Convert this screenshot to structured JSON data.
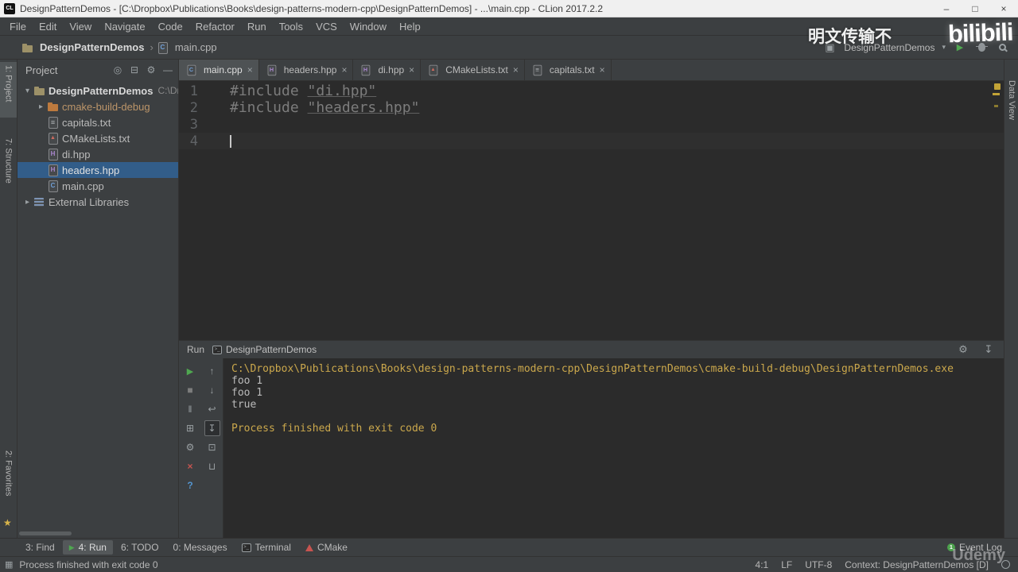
{
  "window": {
    "app_icon_text": "CL",
    "title": "DesignPatternDemos - [C:\\Dropbox\\Publications\\Books\\design-patterns-modern-cpp\\DesignPatternDemos] - ...\\main.cpp - CLion 2017.2.2",
    "controls": {
      "minimize": "–",
      "maximize": "□",
      "close": "×"
    }
  },
  "menu_bar": {
    "items": [
      "File",
      "Edit",
      "View",
      "Navigate",
      "Code",
      "Refactor",
      "Run",
      "Tools",
      "VCS",
      "Window",
      "Help"
    ]
  },
  "navbar": {
    "project": "DesignPatternDemos",
    "separator": "›",
    "file": "main.cpp",
    "run_config": "DesignPatternDemos",
    "dropdown_arrow": "▾"
  },
  "left_strip": {
    "project_tab": "1: Project",
    "structure_tab": "7: Structure",
    "favorites_tab": "2: Favorites",
    "star": "★"
  },
  "right_strip": {
    "data_view_tab": "Data View"
  },
  "project_panel": {
    "header_title": "Project",
    "header_icons": [
      {
        "name": "locate-icon",
        "glyph": "◎"
      },
      {
        "name": "collapse-all-icon",
        "glyph": "⊟"
      },
      {
        "name": "settings-icon",
        "glyph": "⚙"
      },
      {
        "name": "hide-icon",
        "glyph": "—"
      }
    ],
    "tree": [
      {
        "label": "DesignPatternDemos",
        "suffix": "C:\\Drop",
        "icon": "folder",
        "level": 0,
        "expanded": true,
        "bold": true
      },
      {
        "label": "cmake-build-debug",
        "icon": "folder-excluded",
        "level": 1,
        "expanded": false,
        "tint": "#bc9569"
      },
      {
        "label": "capitals.txt",
        "icon": "file-text",
        "level": 1
      },
      {
        "label": "CMakeLists.txt",
        "icon": "file-cmake",
        "level": 1
      },
      {
        "label": "di.hpp",
        "icon": "file-h",
        "level": 1
      },
      {
        "label": "headers.hpp",
        "icon": "file-h",
        "level": 1,
        "selected": true
      },
      {
        "label": "main.cpp",
        "icon": "file-cpp",
        "level": 1
      },
      {
        "label": "External Libraries",
        "icon": "lib",
        "level": 0,
        "expanded": false
      }
    ]
  },
  "editor": {
    "tabs": [
      {
        "label": "main.cpp",
        "icon": "file-cpp",
        "active": true
      },
      {
        "label": "headers.hpp",
        "icon": "file-h"
      },
      {
        "label": "di.hpp",
        "icon": "file-h"
      },
      {
        "label": "CMakeLists.txt",
        "icon": "file-cmake"
      },
      {
        "label": "capitals.txt",
        "icon": "file-text"
      }
    ],
    "close_glyph": "×",
    "lines": [
      {
        "num": "1",
        "segments": [
          {
            "text": "#include ",
            "style": "dim"
          },
          {
            "text": "\"di.hpp\"",
            "style": "dim-underline"
          }
        ]
      },
      {
        "num": "2",
        "segments": [
          {
            "text": "#include ",
            "style": "dim"
          },
          {
            "text": "\"headers.hpp\"",
            "style": "dim-underline"
          }
        ]
      },
      {
        "num": "3",
        "segments": []
      },
      {
        "num": "4",
        "segments": [],
        "caret": true
      }
    ]
  },
  "run_panel": {
    "tab_label": "Run",
    "session_label": "DesignPatternDemos",
    "header_icons": [
      {
        "name": "settings-icon",
        "glyph": "⚙"
      },
      {
        "name": "scroll-down-icon",
        "glyph": "↧"
      }
    ],
    "toolbar_main": [
      {
        "name": "rerun-button",
        "glyph": "▶",
        "color": "#4fa750"
      },
      {
        "name": "stop-button",
        "glyph": "■",
        "color": "#7d7d7d"
      },
      {
        "name": "pause-output-button",
        "glyph": "‖",
        "color": "#9aa0a3"
      },
      {
        "name": "restore-layout-button",
        "glyph": "⊞",
        "color": "#9aa0a3"
      },
      {
        "name": "run-settings-button",
        "glyph": "⚙",
        "color": "#9aa0a3"
      },
      {
        "name": "close-button",
        "glyph": "×",
        "color": "#c75450"
      },
      {
        "name": "help-button",
        "glyph": "?",
        "color": "#5394ce"
      }
    ],
    "toolbar_console": [
      {
        "name": "up-stack-trace-button",
        "glyph": "↑",
        "color": "#9aa0a3"
      },
      {
        "name": "down-stack-trace-button",
        "glyph": "↓",
        "color": "#9aa0a3"
      },
      {
        "name": "soft-wrap-button",
        "glyph": "↩",
        "color": "#9aa0a3"
      },
      {
        "name": "scroll-to-end-button",
        "glyph": "↧",
        "color": "#9aa0a3",
        "pressed": true
      },
      {
        "name": "print-button",
        "glyph": "⊡",
        "color": "#9aa0a3"
      },
      {
        "name": "clear-all-button",
        "glyph": "⊔",
        "color": "#9aa0a3"
      }
    ],
    "console": [
      {
        "text": "C:\\Dropbox\\Publications\\Books\\design-patterns-modern-cpp\\DesignPatternDemos\\cmake-build-debug\\DesignPatternDemos.exe",
        "style": "system"
      },
      {
        "text": "foo 1",
        "style": "plain"
      },
      {
        "text": "foo 1",
        "style": "plain"
      },
      {
        "text": "true",
        "style": "plain"
      },
      {
        "text": "",
        "style": "plain"
      },
      {
        "text": "Process finished with exit code 0",
        "style": "system"
      }
    ]
  },
  "bottom_bar": {
    "left": [
      {
        "label": "3: Find",
        "icon": null
      },
      {
        "label": "4: Run",
        "icon": "run",
        "active": true
      },
      {
        "label": "6: TODO",
        "icon": null
      },
      {
        "label": "0: Messages",
        "icon": null
      },
      {
        "label": "Terminal",
        "icon": "terminal"
      },
      {
        "label": "CMake",
        "icon": "cmake"
      }
    ],
    "right": [
      {
        "label": "Event Log",
        "icon": "event",
        "badge": "1"
      }
    ]
  },
  "status_bar": {
    "message": "Process finished with exit code 0",
    "position": "4:1",
    "line_separator": "LF",
    "encoding": "UTF-8",
    "context": "Context: DesignPatternDemos [D]"
  },
  "watermarks": {
    "top_text": "明文传输不",
    "logo": "bilibili",
    "bottom_logo": "Udemy"
  }
}
